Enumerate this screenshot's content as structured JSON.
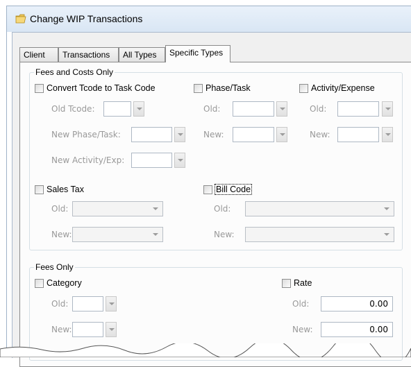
{
  "window": {
    "title": "Change WIP Transactions",
    "icon": "folder-icon"
  },
  "tabs": [
    {
      "label": "Client"
    },
    {
      "label": "Transactions"
    },
    {
      "label": "All Types"
    },
    {
      "label": "Specific Types",
      "active": true
    }
  ],
  "fees_costs": {
    "legend": "Fees and Costs Only",
    "convert_tcode": {
      "label": "Convert Tcode to Task Code",
      "checked": false
    },
    "old_tcode_label": "Old Tcode:",
    "new_phase_label": "New Phase/Task:",
    "new_activity_label": "New Activity/Exp:",
    "phase_task": {
      "label": "Phase/Task",
      "checked": false
    },
    "phase_old_label": "Old:",
    "phase_new_label": "New:",
    "activity_expense": {
      "label": "Activity/Expense",
      "checked": false
    },
    "activity_old_label": "Old:",
    "activity_new_label": "New:",
    "sales_tax": {
      "label": "Sales Tax",
      "checked": false
    },
    "sales_old_label": "Old:",
    "sales_new_label": "New:",
    "bill_code": {
      "label": "Bill Code",
      "checked": false
    },
    "bill_old_label": "Old:",
    "bill_new_label": "New:"
  },
  "fees_only": {
    "legend": "Fees Only",
    "category": {
      "label": "Category",
      "checked": false
    },
    "cat_old_label": "Old:",
    "cat_new_label": "New:",
    "rate": {
      "label": "Rate",
      "checked": false
    },
    "rate_old_label": "Old:",
    "rate_new_label": "New:",
    "rate_old_value": "0.00",
    "rate_new_value": "0.00"
  },
  "colors": {
    "disabled_text": "#999999",
    "title_bar": "#dce8f5"
  }
}
